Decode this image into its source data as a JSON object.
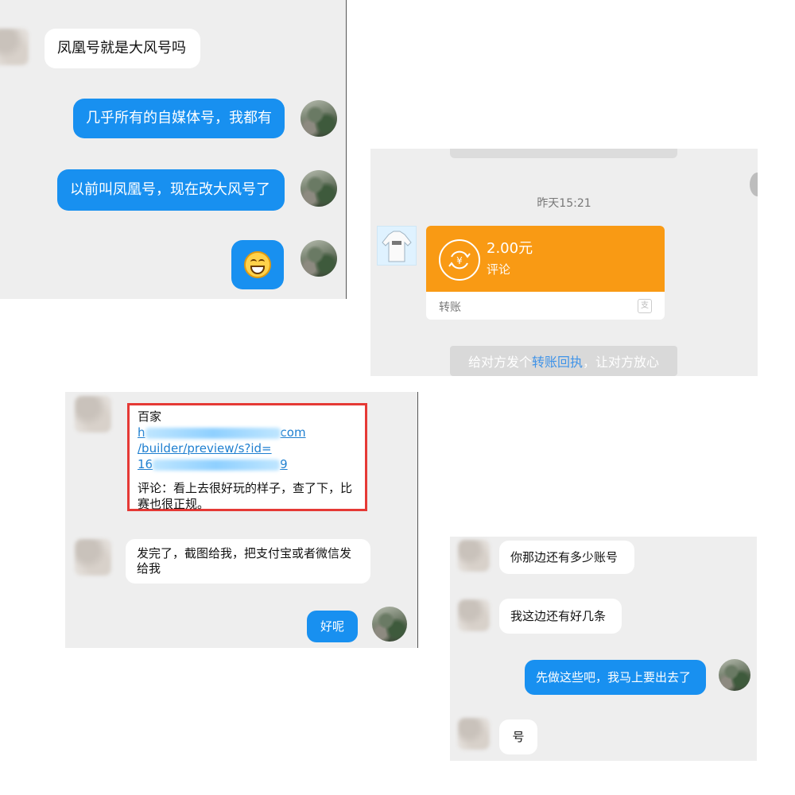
{
  "panel1": {
    "messages": [
      {
        "side": "left",
        "text": "凤凰号就是大风号吗"
      },
      {
        "side": "right",
        "text": "几乎所有的自媒体号，我都有"
      },
      {
        "side": "right",
        "text": "以前叫凤凰号，现在改大风号了"
      },
      {
        "side": "right",
        "emoji": "grin-emoji"
      }
    ]
  },
  "panel2": {
    "time": "昨天15:21",
    "transfer": {
      "amount": "2.00元",
      "note": "评论",
      "footer": "转账"
    },
    "tip": {
      "prefix": "给对方发个 ",
      "link": "转账回执",
      "suffix": "，让对方放心"
    },
    "colors": {
      "card": "#f99a14",
      "link": "#5aa9ff"
    }
  },
  "panel3": {
    "card": {
      "title": "百家",
      "link_line1_suffix": "com",
      "link_line2": "/builder/preview/s?id=",
      "link_line3_prefix": "16",
      "link_line3_suffix": "9",
      "comment": "评论：看上去很好玩的样子，查了下，比赛也很正规。"
    },
    "msg_left": "发完了，截图给我，把支付宝或者微信发给我",
    "msg_right": "好呢",
    "highlight_color": "#e53935"
  },
  "panel4": {
    "messages": [
      {
        "side": "left",
        "text": "你那边还有多少账号"
      },
      {
        "side": "left",
        "text": "我这边还有好几条"
      },
      {
        "side": "right",
        "text": "先做这些吧，我马上要出去了"
      },
      {
        "side": "left",
        "text": "号"
      }
    ]
  }
}
